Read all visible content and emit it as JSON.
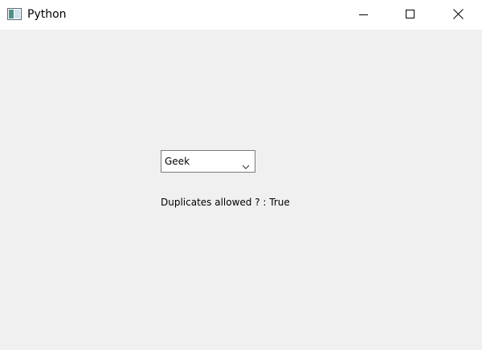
{
  "window": {
    "title": "Python"
  },
  "combo": {
    "selected_value": "Geek"
  },
  "status": {
    "text": "Duplicates allowed ? : True"
  },
  "icons": {
    "app": "window-app-icon",
    "minimize": "minimize-icon",
    "maximize": "maximize-icon",
    "close": "close-icon",
    "dropdown": "chevron-down-icon"
  },
  "colors": {
    "titlebar": "#ffffff",
    "client_area": "#f0f0f0",
    "combo_border": "#7a7a7a"
  }
}
